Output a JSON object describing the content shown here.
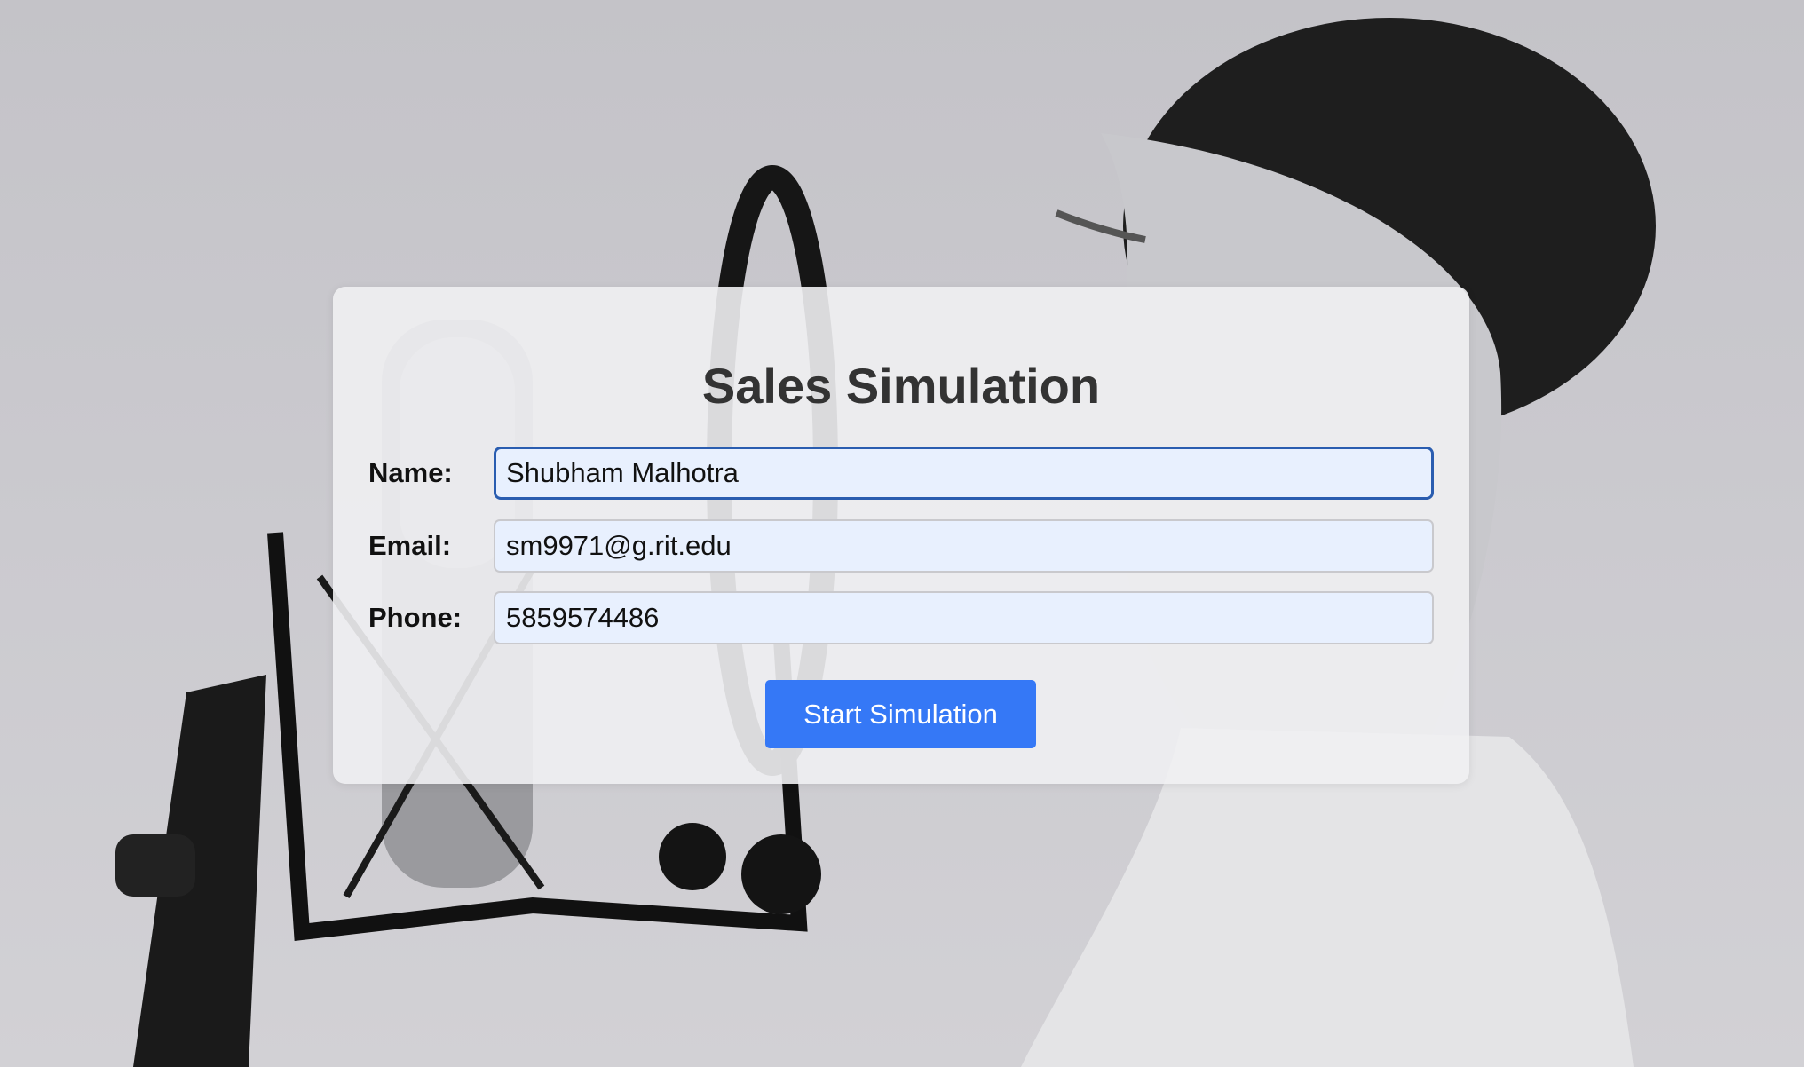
{
  "page": {
    "title": "Sales Simulation"
  },
  "form": {
    "name": {
      "label": "Name:",
      "value": "Shubham Malhotra"
    },
    "email": {
      "label": "Email:",
      "value": "sm9971@g.rit.edu"
    },
    "phone": {
      "label": "Phone:",
      "value": "5859574486"
    },
    "submit_label": "Start Simulation"
  },
  "colors": {
    "button": "#3578f6",
    "input_bg": "#e8f0fe",
    "focus_border": "#2a5db0",
    "title": "#333333"
  }
}
